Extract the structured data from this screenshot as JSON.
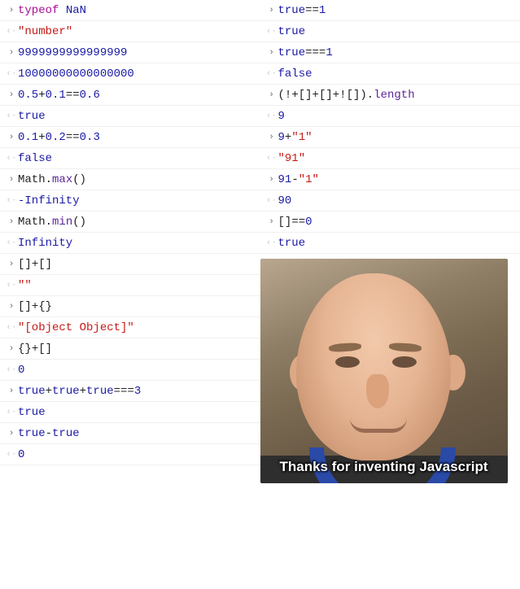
{
  "left": [
    {
      "in": [
        [
          "keyword",
          "typeof"
        ],
        [
          "default",
          " "
        ],
        [
          "kwval",
          "NaN"
        ]
      ],
      "out": [
        [
          "string",
          "\"number\""
        ]
      ]
    },
    {
      "in": [
        [
          "number",
          "9999999999999999"
        ]
      ],
      "out": [
        [
          "number",
          "10000000000000000"
        ]
      ]
    },
    {
      "in": [
        [
          "number",
          "0.5"
        ],
        [
          "op",
          "+"
        ],
        [
          "number",
          "0.1"
        ],
        [
          "op",
          "=="
        ],
        [
          "number",
          "0.6"
        ]
      ],
      "out": [
        [
          "kwval",
          "true"
        ]
      ]
    },
    {
      "in": [
        [
          "number",
          "0.1"
        ],
        [
          "op",
          "+"
        ],
        [
          "number",
          "0.2"
        ],
        [
          "op",
          "=="
        ],
        [
          "number",
          "0.3"
        ]
      ],
      "out": [
        [
          "kwval",
          "false"
        ]
      ]
    },
    {
      "in": [
        [
          "ident",
          "Math"
        ],
        [
          "punc",
          "."
        ],
        [
          "prop",
          "max"
        ],
        [
          "punc",
          "()"
        ]
      ],
      "out": [
        [
          "kwval",
          "-Infinity"
        ]
      ]
    },
    {
      "in": [
        [
          "ident",
          "Math"
        ],
        [
          "punc",
          "."
        ],
        [
          "prop",
          "min"
        ],
        [
          "punc",
          "()"
        ]
      ],
      "out": [
        [
          "kwval",
          "Infinity"
        ]
      ]
    },
    {
      "in": [
        [
          "punc",
          "[]"
        ],
        [
          "op",
          "+"
        ],
        [
          "punc",
          "[]"
        ]
      ],
      "out": [
        [
          "string",
          "\"\""
        ]
      ]
    },
    {
      "in": [
        [
          "punc",
          "[]"
        ],
        [
          "op",
          "+"
        ],
        [
          "punc",
          "{}"
        ]
      ],
      "out": [
        [
          "string",
          "\"[object Object]\""
        ]
      ]
    },
    {
      "in": [
        [
          "punc",
          "{}"
        ],
        [
          "op",
          "+"
        ],
        [
          "punc",
          "[]"
        ]
      ],
      "out": [
        [
          "number",
          "0"
        ]
      ]
    },
    {
      "in": [
        [
          "kwval",
          "true"
        ],
        [
          "op",
          "+"
        ],
        [
          "kwval",
          "true"
        ],
        [
          "op",
          "+"
        ],
        [
          "kwval",
          "true"
        ],
        [
          "op",
          "==="
        ],
        [
          "number",
          "3"
        ]
      ],
      "out": [
        [
          "kwval",
          "true"
        ]
      ]
    },
    {
      "in": [
        [
          "kwval",
          "true"
        ],
        [
          "op",
          "-"
        ],
        [
          "kwval",
          "true"
        ]
      ],
      "out": [
        [
          "number",
          "0"
        ]
      ]
    }
  ],
  "right": [
    {
      "in": [
        [
          "kwval",
          "true"
        ],
        [
          "op",
          "=="
        ],
        [
          "number",
          "1"
        ]
      ],
      "out": [
        [
          "kwval",
          "true"
        ]
      ]
    },
    {
      "in": [
        [
          "kwval",
          "true"
        ],
        [
          "op",
          "==="
        ],
        [
          "number",
          "1"
        ]
      ],
      "out": [
        [
          "kwval",
          "false"
        ]
      ]
    },
    {
      "in": [
        [
          "punc",
          "("
        ],
        [
          "op",
          "!"
        ],
        [
          "op",
          "+"
        ],
        [
          "punc",
          "[]"
        ],
        [
          "op",
          "+"
        ],
        [
          "punc",
          "[]"
        ],
        [
          "op",
          "+"
        ],
        [
          "op",
          "!"
        ],
        [
          "punc",
          "[]"
        ],
        [
          "punc",
          ")"
        ],
        [
          "punc",
          "."
        ],
        [
          "prop",
          "length"
        ]
      ],
      "out": [
        [
          "number",
          "9"
        ]
      ]
    },
    {
      "in": [
        [
          "number",
          "9"
        ],
        [
          "op",
          "+"
        ],
        [
          "string",
          "\"1\""
        ]
      ],
      "out": [
        [
          "string",
          "\"91\""
        ]
      ]
    },
    {
      "in": [
        [
          "number",
          "91"
        ],
        [
          "op",
          "-"
        ],
        [
          "string",
          "\"1\""
        ]
      ],
      "out": [
        [
          "number",
          "90"
        ]
      ]
    },
    {
      "in": [
        [
          "punc",
          "[]"
        ],
        [
          "op",
          "=="
        ],
        [
          "number",
          "0"
        ]
      ],
      "out": [
        [
          "kwval",
          "true"
        ]
      ]
    }
  ],
  "meme": {
    "caption": "Thanks for inventing Javascript"
  },
  "glyphs": {
    "input_arrow": "›",
    "output_arrow": "‹·"
  }
}
